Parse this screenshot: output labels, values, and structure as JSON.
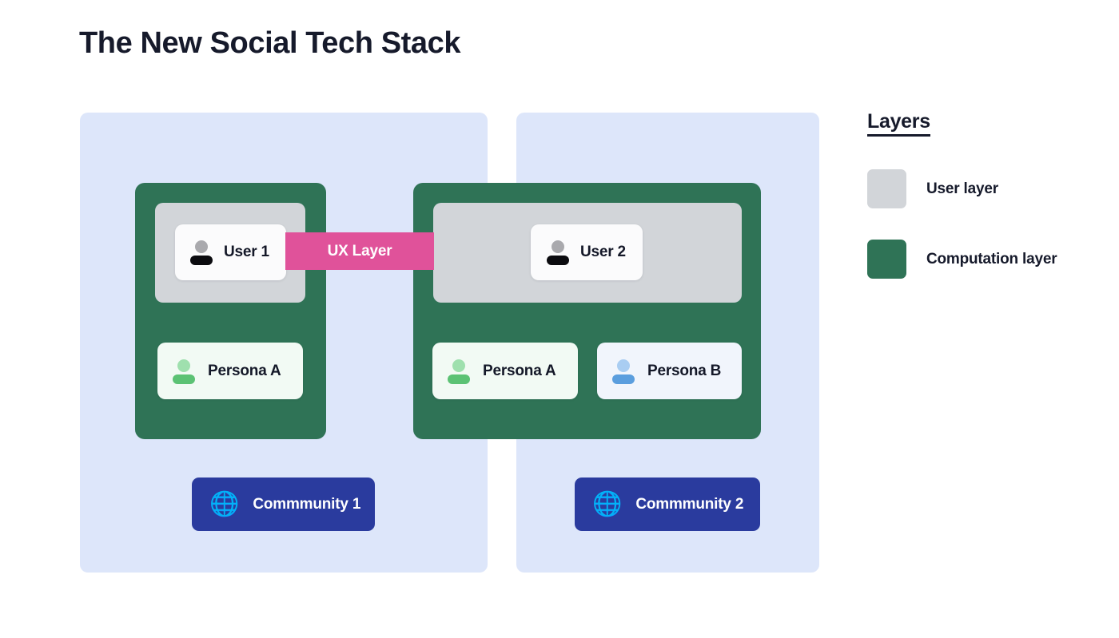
{
  "page": {
    "title": "The New Social Tech Stack"
  },
  "colors": {
    "group_panel": "#dde6fa",
    "computation_layer": "#2f7356",
    "user_layer": "#d2d5d9",
    "ux_layer": "#e0529a",
    "community_button": "#2a3b9e",
    "title_text": "#161a2b"
  },
  "groups": [
    {
      "id": "group-1",
      "user_layer": {
        "cards": [
          {
            "label": "User 1",
            "icon": "person-icon"
          }
        ]
      },
      "personas": [
        {
          "label": "Persona A",
          "icon": "person-icon"
        }
      ],
      "community": {
        "label": "Commmunity 1",
        "icon": "globe-with-people-icon",
        "glyph": "🌐"
      }
    },
    {
      "id": "group-2",
      "user_layer": {
        "cards": [
          {
            "label": "User 2",
            "icon": "person-icon"
          }
        ]
      },
      "personas": [
        {
          "label": "Persona A",
          "icon": "person-icon"
        },
        {
          "label": "Persona B",
          "icon": "person-icon"
        }
      ],
      "community": {
        "label": "Commmunity 2",
        "icon": "globe-with-people-icon",
        "glyph": "🌐"
      }
    }
  ],
  "ux_layer": {
    "label": "UX Layer"
  },
  "legend": {
    "title": "Layers",
    "items": [
      {
        "label": "User layer",
        "color": "#d2d5d9"
      },
      {
        "label": "Computation layer",
        "color": "#2f7356"
      }
    ]
  }
}
